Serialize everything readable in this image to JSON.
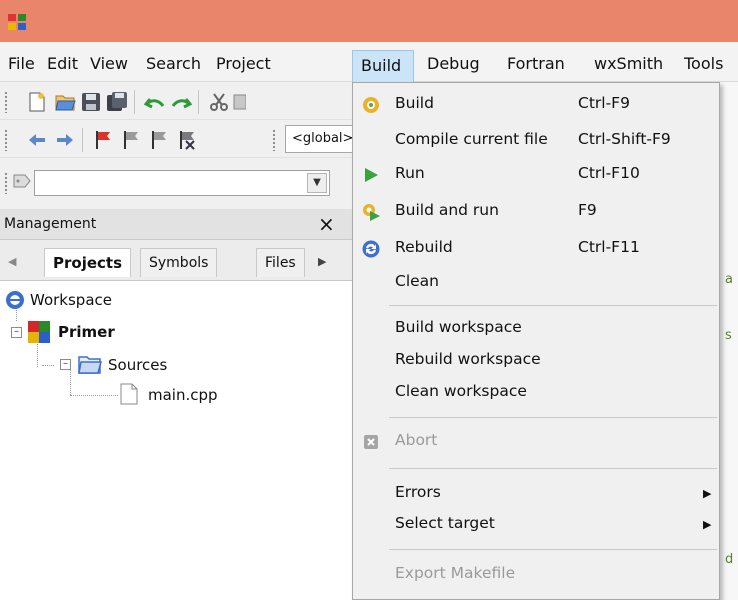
{
  "menubar": {
    "items": [
      "File",
      "Edit",
      "View",
      "Search",
      "Project",
      "Build",
      "Debug",
      "Fortran",
      "wxSmith",
      "Tools"
    ]
  },
  "toolbar": {
    "scope_text": "<global>"
  },
  "management": {
    "title": "Management",
    "close_glyph": "×",
    "tabs": [
      "Projects",
      "Symbols",
      "Files"
    ],
    "selected_tab": "Projects"
  },
  "tree": {
    "workspace": "Workspace",
    "project": "Primer",
    "folder": "Sources",
    "file": "main.cpp"
  },
  "build_menu": {
    "items": [
      {
        "label": "Build",
        "shortcut": "Ctrl-F9",
        "icon": "gear-icon"
      },
      {
        "label": "Compile current file",
        "shortcut": "Ctrl-Shift-F9",
        "icon": ""
      },
      {
        "label": "Run",
        "shortcut": "Ctrl-F10",
        "icon": "play-icon"
      },
      {
        "label": "Build and run",
        "shortcut": "F9",
        "icon": "gear-play-icon"
      },
      {
        "label": "Rebuild",
        "shortcut": "Ctrl-F11",
        "icon": "rebuild-icon"
      },
      {
        "label": "Clean",
        "shortcut": "",
        "icon": ""
      },
      {
        "label": "Build workspace",
        "shortcut": "",
        "icon": ""
      },
      {
        "label": "Rebuild workspace",
        "shortcut": "",
        "icon": ""
      },
      {
        "label": "Clean workspace",
        "shortcut": "",
        "icon": ""
      },
      {
        "label": "Abort",
        "shortcut": "",
        "icon": "abort-icon",
        "disabled": true
      },
      {
        "label": "Errors",
        "shortcut": "",
        "icon": "",
        "submenu": true
      },
      {
        "label": "Select target",
        "shortcut": "",
        "icon": "",
        "submenu": true
      },
      {
        "label": "Export Makefile",
        "shortcut": "",
        "icon": "",
        "disabled": true
      }
    ]
  },
  "colors": {
    "titlebar": "#e8856b",
    "menu_highlight": "#cce4f7",
    "menu_background": "#f0f0f0"
  }
}
